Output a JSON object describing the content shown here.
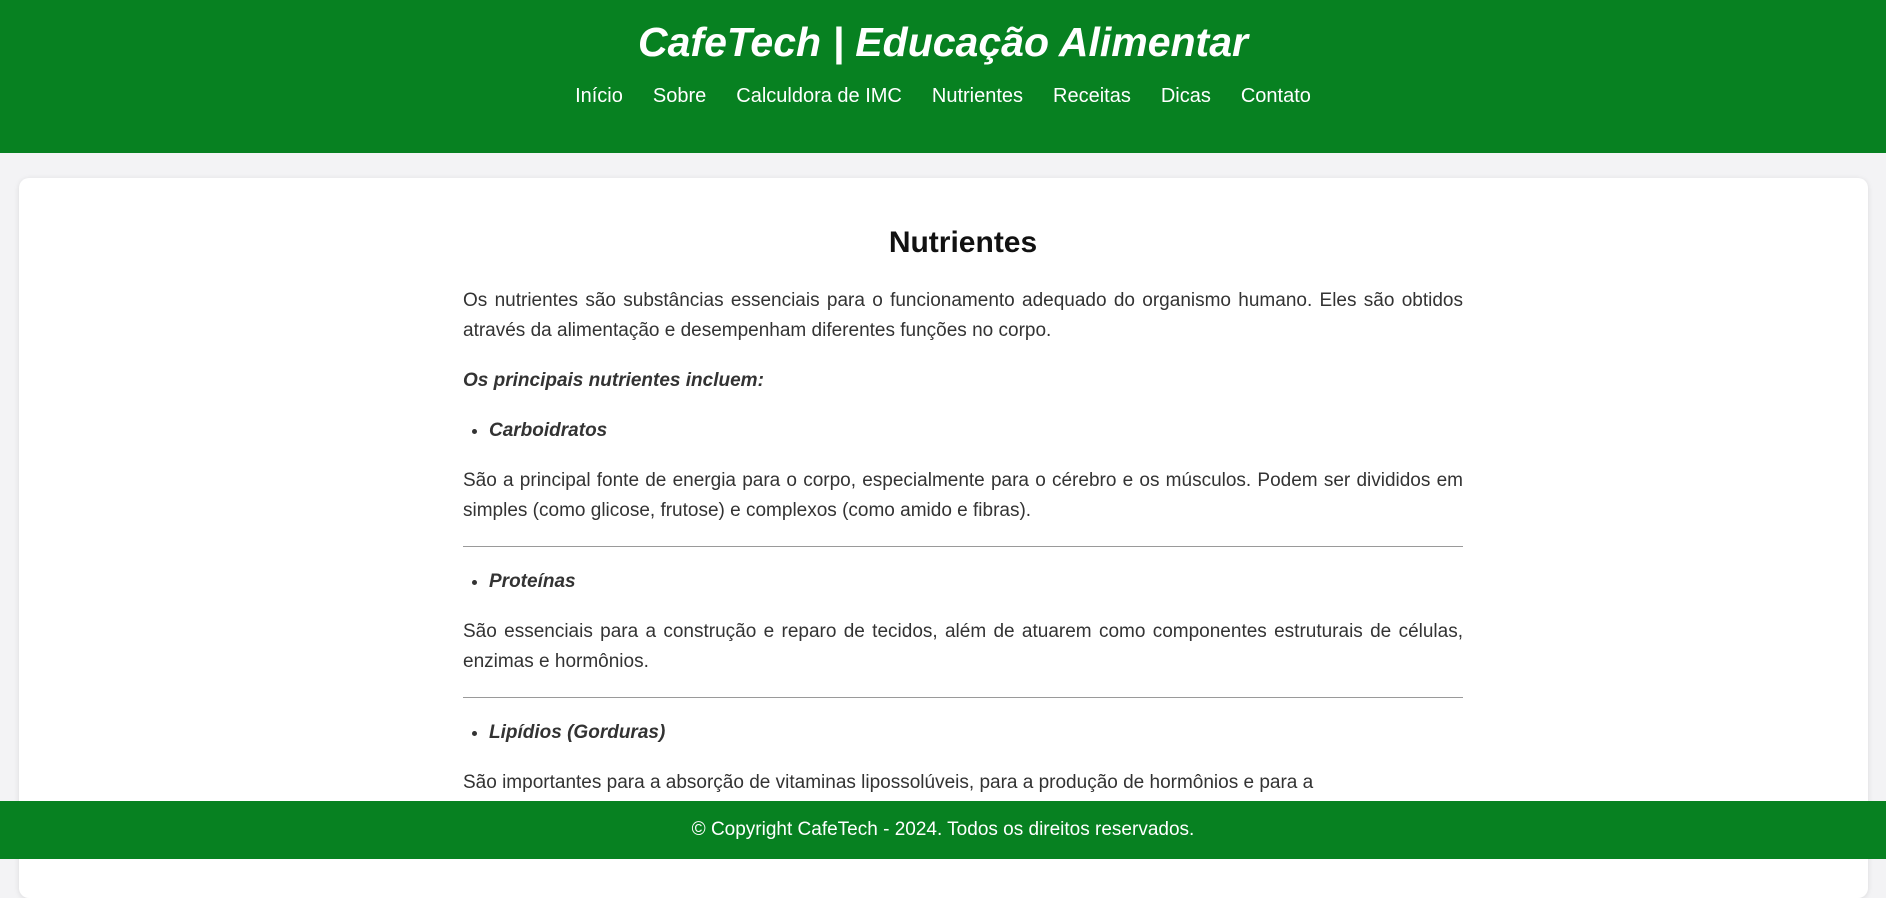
{
  "header": {
    "title": "CafeTech | Educação Alimentar",
    "nav": [
      "Início",
      "Sobre",
      "Calculdora de IMC",
      "Nutrientes",
      "Receitas",
      "Dicas",
      "Contato"
    ]
  },
  "main": {
    "heading": "Nutrientes",
    "intro": "Os nutrientes são substâncias essenciais para o funcionamento adequado do organismo humano. Eles são obtidos através da alimentação e desempenham diferentes funções no corpo.",
    "list_heading": "Os principais nutrientes incluem:",
    "nutrients": [
      {
        "name": "Carboidratos",
        "description": "São a principal fonte de energia para o corpo, especialmente para o cérebro e os músculos. Podem ser divididos em simples (como glicose, frutose) e complexos (como amido e fibras)."
      },
      {
        "name": "Proteínas",
        "description": "São essenciais para a construção e reparo de tecidos, além de atuarem como componentes estruturais de células, enzimas e hormônios."
      },
      {
        "name": "Lipídios (Gorduras)",
        "description": "São importantes para a absorção de vitaminas lipossolúveis, para a produção de hormônios e para a"
      }
    ]
  },
  "footer": {
    "text": "© Copyright CafeTech - 2024. Todos os direitos reservados."
  },
  "colors": {
    "brand_green": "#078121",
    "page_background": "#f3f3f5",
    "text": "#333333"
  }
}
